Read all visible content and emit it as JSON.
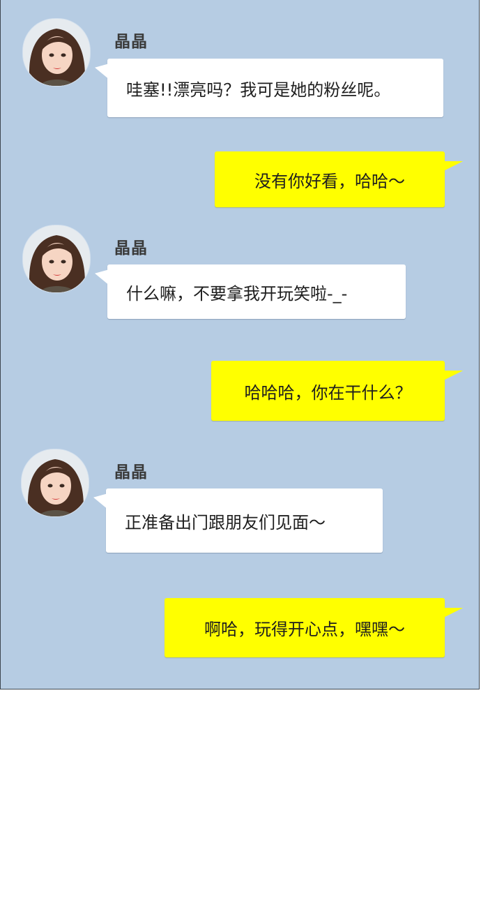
{
  "colors": {
    "chat_background": "#b6cce3",
    "incoming_bubble": "#ffffff",
    "outgoing_bubble": "#ffff00",
    "page_background": "#ffffff"
  },
  "messages": [
    {
      "sender": "晶晶",
      "direction": "incoming",
      "text": "哇塞!!漂亮吗？我可是她的粉丝呢。"
    },
    {
      "direction": "outgoing",
      "text": "没有你好看，哈哈～"
    },
    {
      "sender": "晶晶",
      "direction": "incoming",
      "text": "什么嘛，不要拿我开玩笑啦-_-"
    },
    {
      "direction": "outgoing",
      "text": "哈哈哈，你在干什么？"
    },
    {
      "sender": "晶晶",
      "direction": "incoming",
      "text": "正准备出门跟朋友们见面～"
    },
    {
      "direction": "outgoing",
      "text": "啊哈，玩得开心点，嘿嘿～"
    }
  ]
}
